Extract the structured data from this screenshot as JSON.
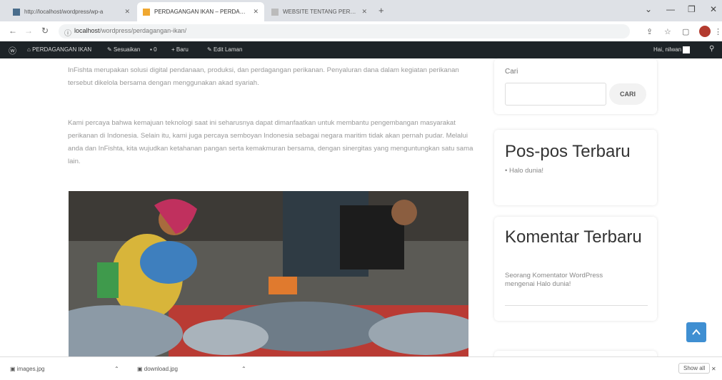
{
  "browser": {
    "tabs": [
      {
        "title": "http://localhost/wordpress/wp-a",
        "active": false
      },
      {
        "title": "PERDAGANGAN IKAN – PERDAGAN",
        "active": true
      },
      {
        "title": "WEBSITE TENTANG PERDAGANG",
        "active": false
      }
    ],
    "new_tab": "+",
    "url_host": "localhost",
    "url_path": "/wordpress/perdagangan-ikan/"
  },
  "admin_bar": {
    "wp_logo": "wordpress-logo-icon",
    "site": "PERDAGANGAN IKAN",
    "customize": "Sesuaikan",
    "comments_count": "0",
    "new": "Baru",
    "edit": "Edit Laman",
    "greeting": "Hai, nilwan"
  },
  "article": {
    "p1": "InFishta merupakan solusi digital pendanaan, produksi, dan perdagangan perikanan. Penyaluran dana dalam kegiatan perikanan tersebut dikelola bersama dengan menggunakan akad syariah.",
    "p2": "Kami percaya bahwa kemajuan teknologi saat ini seharusnya dapat dimanfaatkan untuk membantu pengembangan masyarakat perikanan di Indonesia. Selain itu, kami juga percaya semboyan Indonesia sebagai negara maritim tidak akan pernah pudar. Melalui anda dan InFishta, kita wujudkan ketahanan pangan serta kemakmuran bersama, dengan sinergitas yang menguntungkan satu sama lain."
  },
  "sidebar": {
    "search_label": "Cari",
    "search_button": "CARI",
    "recent_posts_title": "Pos-pos Terbaru",
    "recent_posts": [
      "Halo dunia!"
    ],
    "recent_comments_title": "Komentar Terbaru",
    "comment_author": "Seorang Komentator WordPress",
    "comment_text": "mengenai Halo dunia!"
  },
  "downloads": {
    "items": [
      "images.jpg",
      "download.jpg"
    ],
    "show_all": "Show all"
  }
}
